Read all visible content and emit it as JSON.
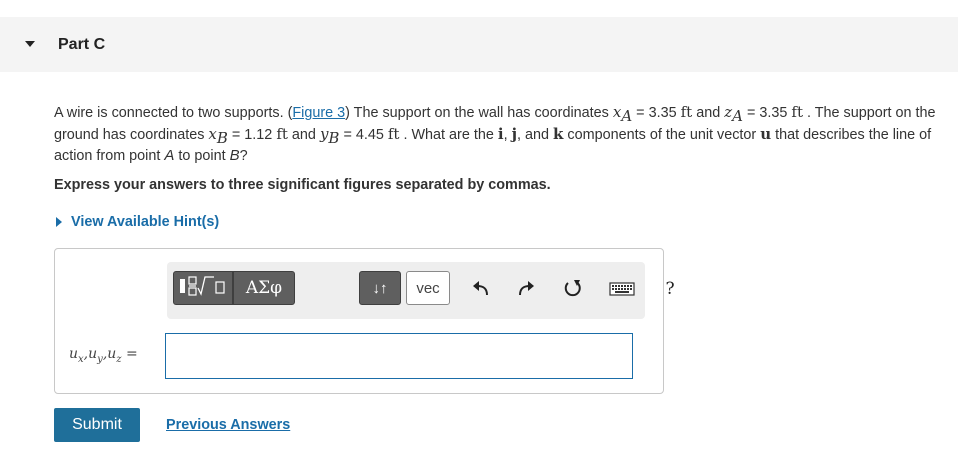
{
  "part": {
    "title": "Part C"
  },
  "question": {
    "t1": "A wire is connected to two supports. (",
    "figure_link": "Figure 3",
    "t2": ") The support on the wall has coordinates ",
    "xA_var": "x",
    "xA_sub": "A",
    "xA_val": " = 3.35 ",
    "unit": "ft",
    "t3": " and ",
    "zA_var": "z",
    "zA_sub": "A",
    "zA_val": " = 3.35 ",
    "t4": " . The support on the ground has coordinates ",
    "xB_var": "x",
    "xB_sub": "B",
    "xB_val": " = 1.12 ",
    "t5": " and ",
    "yB_var": "y",
    "yB_sub": "B",
    "yB_val": " = 4.45 ",
    "t6": " . What are the ",
    "i": "i",
    "c1": ", ",
    "j": "j",
    "t7": ", and ",
    "k": "k",
    "t8": " components of the unit vector ",
    "u": "u",
    "t9": " that describes the line of action from point ",
    "pA": "A",
    "t10": " to point ",
    "pB": "B",
    "t11": "?"
  },
  "instruction": "Express your answers to three significant figures separated by commas.",
  "hint_link": "View Available Hint(s)",
  "toolbar": {
    "templates_icon": "fraction-radical-icon",
    "greek_label": "ΑΣφ",
    "arrows_label": "↓↑",
    "vec_label": "vec",
    "undo_icon": "undo-icon",
    "redo_icon": "redo-icon",
    "reset_icon": "reset-icon",
    "keyboard_icon": "keyboard-icon",
    "help_label": "?"
  },
  "answer": {
    "label_ux": "u",
    "label_x": "x",
    "label_sep1": ",",
    "label_uy": "u",
    "label_y": "y",
    "label_sep2": ",",
    "label_uz": "u",
    "label_z": "z",
    "label_eq": " =",
    "value": ""
  },
  "actions": {
    "submit_label": "Submit",
    "previous_answers": "Previous Answers"
  },
  "colors": {
    "link": "#1a6da8",
    "submit_bg": "#1f6f9a",
    "toolbar_btn": "#5f5f5f"
  }
}
